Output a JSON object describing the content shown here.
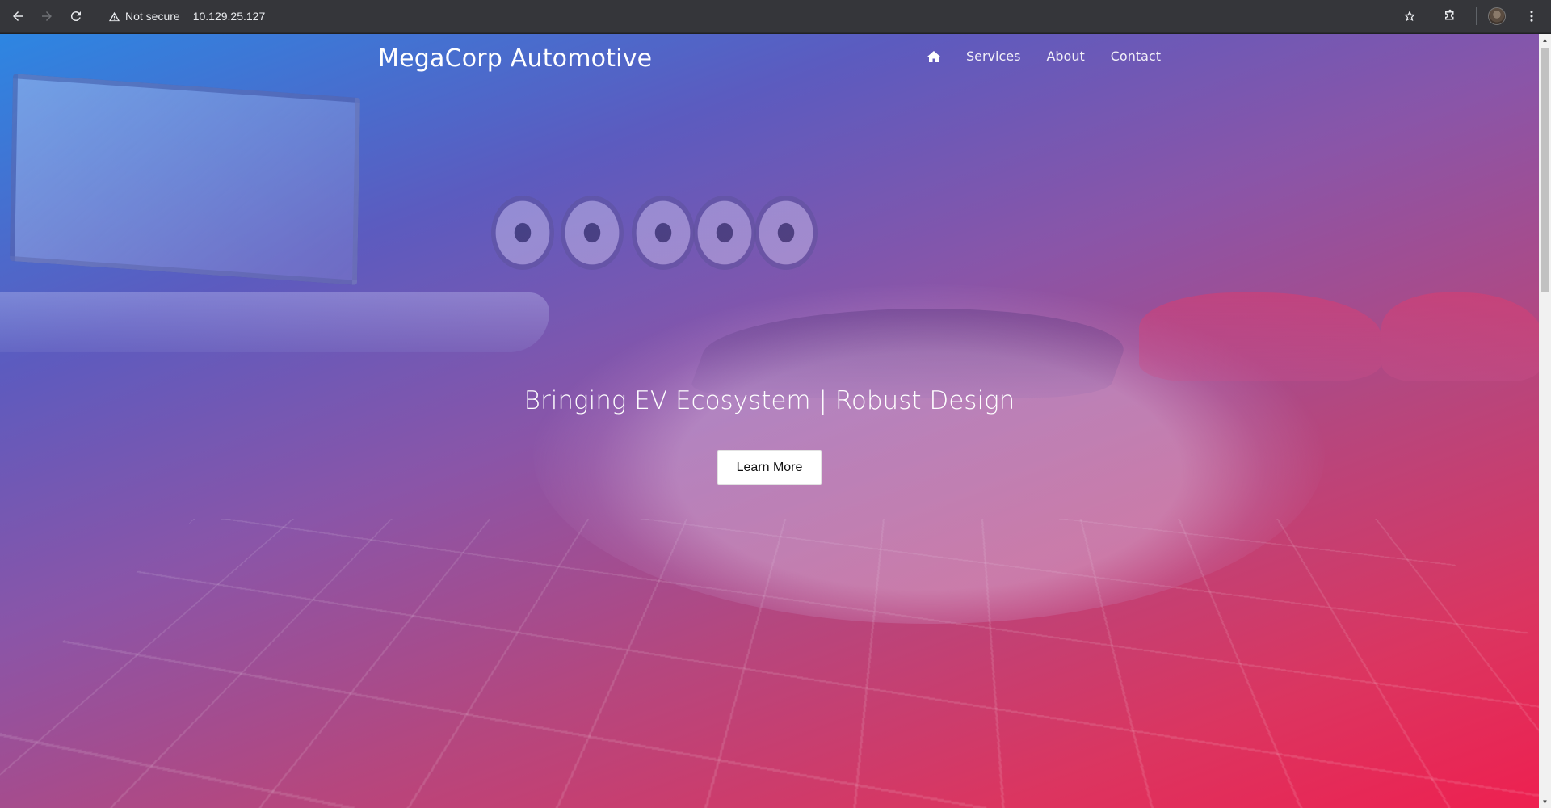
{
  "browser": {
    "security_label": "Not secure",
    "url": "10.129.25.127"
  },
  "site": {
    "brand": "MegaCorp Automotive",
    "nav": {
      "home_icon": "home-icon",
      "items": [
        "Services",
        "About",
        "Contact"
      ]
    }
  },
  "hero": {
    "title": "Bringing EV Ecosystem | Robust Design",
    "button_label": "Learn More"
  },
  "colors": {
    "gradient_start": "#2d86e2",
    "gradient_end": "#ee2050"
  }
}
